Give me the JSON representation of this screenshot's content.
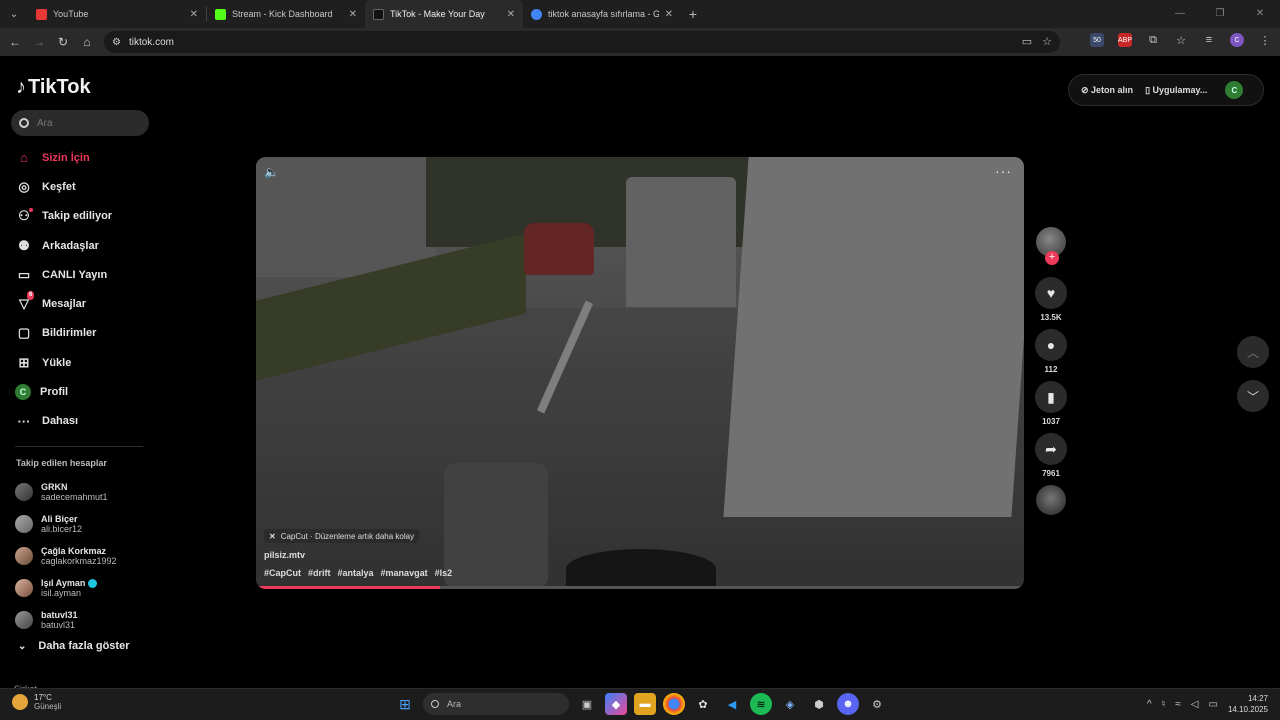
{
  "browser": {
    "tabs": [
      {
        "title": "YouTube",
        "color": "#e53935",
        "active": false
      },
      {
        "title": "Stream - Kick Dashboard",
        "color": "#53fc18",
        "active": false
      },
      {
        "title": "TikTok - Make Your Day",
        "color": "#111111",
        "active": true
      },
      {
        "title": "tiktok anasayfa sıfırlama - Goog",
        "color": "#4285f4",
        "active": false
      }
    ],
    "url": "tiktok.com",
    "ext_badge": "50"
  },
  "tiktok": {
    "logo_text": "TikTok",
    "search_placeholder": "Ara",
    "nav": [
      {
        "label": "Sizin İçin",
        "icon": "home-icon",
        "glyph": "⌂",
        "active": true
      },
      {
        "label": "Keşfet",
        "icon": "compass-icon",
        "glyph": "◎"
      },
      {
        "label": "Takip ediliyor",
        "icon": "following-icon",
        "glyph": "⚇"
      },
      {
        "label": "Arkadaşlar",
        "icon": "friends-icon",
        "glyph": "⚉"
      },
      {
        "label": "CANLI Yayın",
        "icon": "live-icon",
        "glyph": "▭"
      },
      {
        "label": "Mesajlar",
        "icon": "messages-icon",
        "glyph": "▽",
        "badge": "6"
      },
      {
        "label": "Bildirimler",
        "icon": "notifications-icon",
        "glyph": "▢"
      },
      {
        "label": "Yükle",
        "icon": "upload-icon",
        "glyph": "⊞"
      },
      {
        "label": "Profil",
        "icon": "profile-icon",
        "glyph": "C"
      },
      {
        "label": "Dahası",
        "icon": "more-icon",
        "glyph": "···"
      }
    ],
    "following_title": "Takip edilen hesaplar",
    "following": [
      {
        "name": "GRKN",
        "handle": "sadecemahmut1",
        "verified": false
      },
      {
        "name": "Ali Biçer",
        "handle": "ali.bicer12",
        "verified": false
      },
      {
        "name": "Çağla Korkmaz",
        "handle": "caglakorkmaz1992",
        "verified": false
      },
      {
        "name": "Işıl Ayman",
        "handle": "isil.ayman",
        "verified": true
      },
      {
        "name": "batuvl31",
        "handle": "batuvl31",
        "verified": false
      }
    ],
    "show_more": "Daha fazla göster",
    "cutoff_text": "Şirket",
    "top_right": {
      "coins": "Jeton alın",
      "app": "Uygulamay...",
      "avatar": "C"
    },
    "video": {
      "capcut": "CapCut · Düzenleme artık daha kolay",
      "username": "pilsiz.mtv",
      "hashtags": [
        "#CapCut",
        "#drift",
        "#antalya",
        "#manavgat",
        "#ls2"
      ],
      "progress": 0.24
    },
    "actions": {
      "likes": "13.5K",
      "comments": "112",
      "saves": "1037",
      "shares": "7961"
    }
  },
  "taskbar": {
    "temp": "17°C",
    "weather": "Güneşli",
    "search": "Ara",
    "time": "14:27",
    "date": "14.10.2025"
  }
}
